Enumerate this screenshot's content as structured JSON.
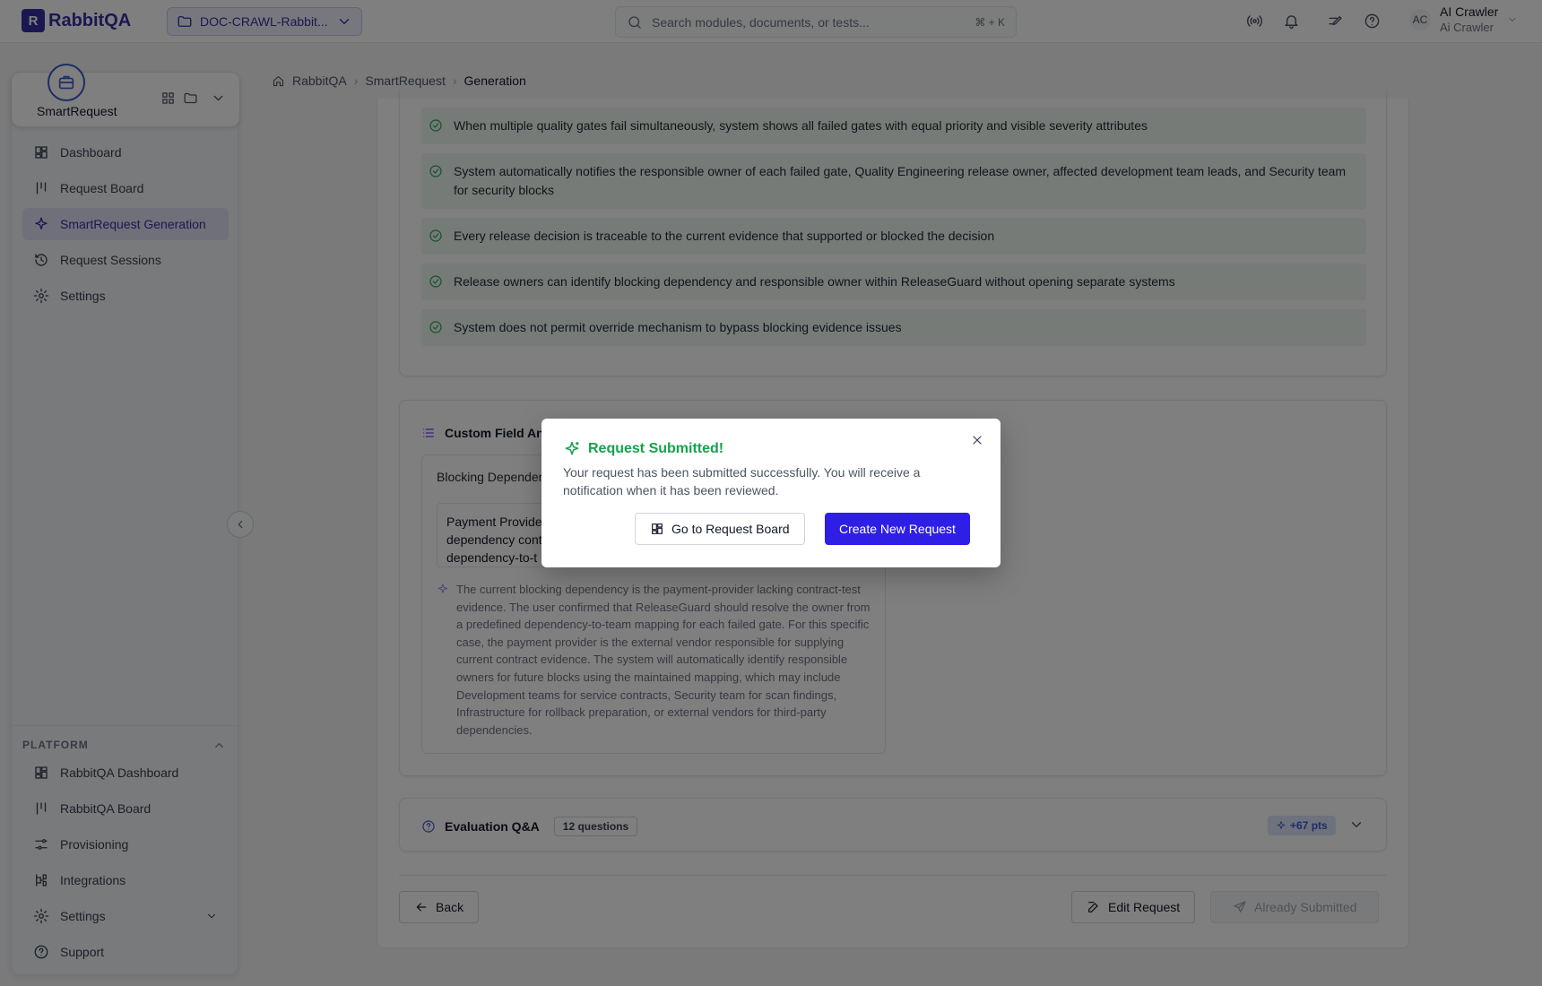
{
  "topbar": {
    "brand": "RabbitQA",
    "project": "DOC-CRAWL-Rabbit...",
    "search_placeholder": "Search modules, documents, or tests...",
    "search_shortcut": "⌘ + K",
    "user_initials": "AC",
    "user_name": "AI Crawler",
    "user_role": "Ai Crawler"
  },
  "sidebar": {
    "module_name": "SmartRequest",
    "items": [
      {
        "label": "Dashboard",
        "icon": "dashboard-icon"
      },
      {
        "label": "Request Board",
        "icon": "board-icon"
      },
      {
        "label": "SmartRequest Generation",
        "icon": "sparkle-icon",
        "active": true
      },
      {
        "label": "Request Sessions",
        "icon": "history-icon"
      },
      {
        "label": "Settings",
        "icon": "gear-icon"
      }
    ],
    "platform_heading": "PLATFORM",
    "platform_items": [
      {
        "label": "RabbitQA Dashboard",
        "icon": "dashboard-icon"
      },
      {
        "label": "RabbitQA Board",
        "icon": "board-icon"
      },
      {
        "label": "Provisioning",
        "icon": "sliders-icon"
      },
      {
        "label": "Integrations",
        "icon": "integrations-icon"
      },
      {
        "label": "Settings",
        "icon": "gear-icon"
      },
      {
        "label": "Support",
        "icon": "help-icon"
      }
    ]
  },
  "breadcrumb": [
    "RabbitQA",
    "SmartRequest",
    "Generation"
  ],
  "acceptance_criteria": [
    "When multiple quality gates fail simultaneously, system shows all failed gates with equal priority and visible severity attributes",
    "System automatically notifies the responsible owner of each failed gate, Quality Engineering release owner, affected development team leads, and Security team for security blocks",
    "Every release decision is traceable to the current evidence that supported or blocked the decision",
    "Release owners can identify blocking dependency and responsible owner within ReleaseGuard without opening separate systems",
    "System does not permit override mechanism to bypass blocking evidence issues"
  ],
  "custom_fields": {
    "title": "Custom Field Ans",
    "question": "Blocking Depender",
    "answer_lines": [
      "Payment Provide",
      "dependency cont",
      "dependency-to-t"
    ],
    "ai_note": "The current blocking dependency is the payment-provider lacking contract-test evidence. The user confirmed that ReleaseGuard should resolve the owner from a predefined dependency-to-team mapping for each failed gate. For this specific case, the payment provider is the external vendor responsible for supplying current contract evidence. The system will automatically identify responsible owners for future blocks using the maintained mapping, which may include Development teams for service contracts, Security team for scan findings, Infrastructure for rollback preparation, or external vendors for third-party dependencies."
  },
  "evaluation": {
    "title": "Evaluation Q&A",
    "badge": "12 questions",
    "points": "+67 pts"
  },
  "footer": {
    "back": "Back",
    "edit": "Edit Request",
    "submitted": "Already Submitted"
  },
  "modal": {
    "title": "Request Submitted!",
    "message": "Your request has been submitted successfully. You will receive a notification when it has been reviewed.",
    "primary": "Create New Request",
    "secondary": "Go to Request Board"
  },
  "colors": {
    "accent": "#3730a3",
    "primary_button": "#2e1ee6",
    "success": "#16a34a"
  }
}
